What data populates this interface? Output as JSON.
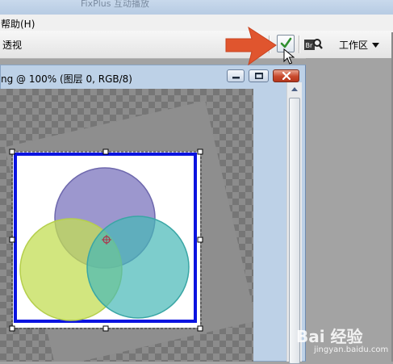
{
  "window": {
    "title": "FixPlus 互动播放"
  },
  "menu": {
    "help_label": "帮助(H)"
  },
  "options_bar": {
    "perspective_label": "透视",
    "workspace_label": "工作区"
  },
  "document": {
    "title": "ng @ 100% (图层 0, RGB/8)"
  },
  "icons": {
    "commit": "checkmark-icon",
    "bridge": "bridge-icon",
    "workspace_chevron": "chevron-down-icon",
    "minimize": "minimize-icon",
    "maximize": "maximize-icon",
    "close": "close-icon",
    "scroll_up": "arrow-up-icon",
    "annotation_arrow": "arrow-right-icon",
    "cursor": "mouse-pointer-icon"
  },
  "colors": {
    "commit_check": "#2f8f2f",
    "callout_arrow": "#e0552e",
    "transform_border": "#0a14e0",
    "circle_purple": "#7b74bd",
    "circle_green": "#c3de54",
    "circle_teal": "#46b8b7"
  },
  "watermark": {
    "text": "Bai 经验",
    "sub": "jingyan.baidu.com"
  }
}
